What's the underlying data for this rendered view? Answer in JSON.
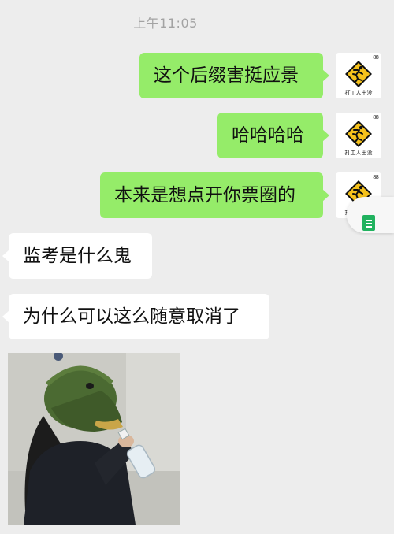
{
  "chat": {
    "timestamp": "上午11:05",
    "messages": [
      {
        "direction": "sent",
        "text": "这个后缀害挺应景"
      },
      {
        "direction": "sent",
        "text": "哈哈哈哈"
      },
      {
        "direction": "sent",
        "text": "本来是想点开你票圈的"
      },
      {
        "direction": "received",
        "text": "监考是什么鬼"
      },
      {
        "direction": "received",
        "text": "为什么可以这么随意取消了"
      }
    ],
    "self_avatar": {
      "icon": "warning-sign-running-worker",
      "caption": "打工人出没",
      "dots": "88"
    },
    "image_message": {
      "icon": "person-in-fish-mask-drinking"
    }
  },
  "floating_widget": {
    "icon": "document-icon"
  },
  "colors": {
    "background": "#ededed",
    "sent_bubble": "#95ec69",
    "received_bubble": "#ffffff",
    "timestamp_text": "#a3a3a3",
    "sign_yellow": "#f6c21c"
  }
}
